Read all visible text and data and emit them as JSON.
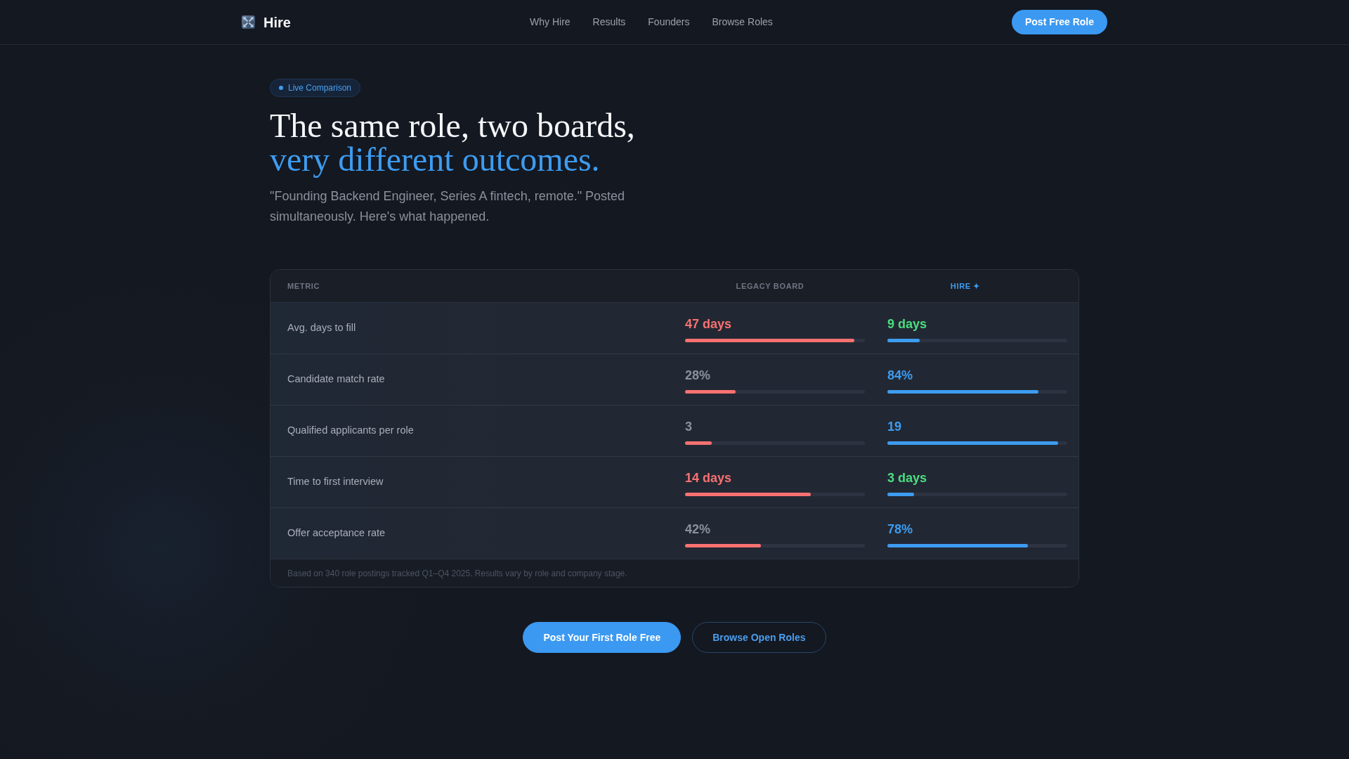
{
  "nav": {
    "brand": "Hire",
    "links": [
      "Why Hire",
      "Results",
      "Founders",
      "Browse Roles"
    ],
    "cta": "Post Free Role"
  },
  "hero": {
    "badge": "Live Comparison",
    "title_line_1": "The same role, two boards,",
    "title_line_2": "very different outcomes.",
    "subtitle": "\"Founding Backend Engineer, Series A fintech, remote.\" Posted simultaneously. Here's what happened."
  },
  "comparison": {
    "columns": [
      {
        "label": "METRIC"
      },
      {
        "label": "LEGACY BOARD",
        "highlight": false,
        "color": "#f87171"
      },
      {
        "label": "HIRE ✦",
        "highlight": true,
        "color": "#3d9cf0"
      }
    ],
    "rows": [
      {
        "metric": "Avg. days to fill",
        "values": [
          {
            "value": "47 days",
            "color": "#f87171",
            "level": 0.94
          },
          {
            "value": "9 days",
            "color": "#4ade80",
            "level": 0.18
          }
        ]
      },
      {
        "metric": "Candidate match rate",
        "values": [
          {
            "value": "28%",
            "color": "#8b919c",
            "level": 0.28
          },
          {
            "value": "84%",
            "color": "#3d9cf0",
            "level": 0.84
          }
        ]
      },
      {
        "metric": "Qualified applicants per role",
        "values": [
          {
            "value": "3",
            "color": "#8b919c",
            "level": 0.15
          },
          {
            "value": "19",
            "color": "#3d9cf0",
            "level": 0.95
          }
        ]
      },
      {
        "metric": "Time to first interview",
        "values": [
          {
            "value": "14 days",
            "color": "#f87171",
            "level": 0.7
          },
          {
            "value": "3 days",
            "color": "#4ade80",
            "level": 0.15
          }
        ]
      },
      {
        "metric": "Offer acceptance rate",
        "values": [
          {
            "value": "42%",
            "color": "#8b919c",
            "level": 0.42
          },
          {
            "value": "78%",
            "color": "#3d9cf0",
            "level": 0.78
          }
        ]
      }
    ],
    "footnote": "Based on 340 role postings tracked Q1–Q4 2025. Results vary by role and company stage."
  },
  "actions": [
    {
      "label": "Post Your First Role Free",
      "kind": "primary"
    },
    {
      "label": "Browse Open Roles",
      "kind": "secondary"
    }
  ]
}
